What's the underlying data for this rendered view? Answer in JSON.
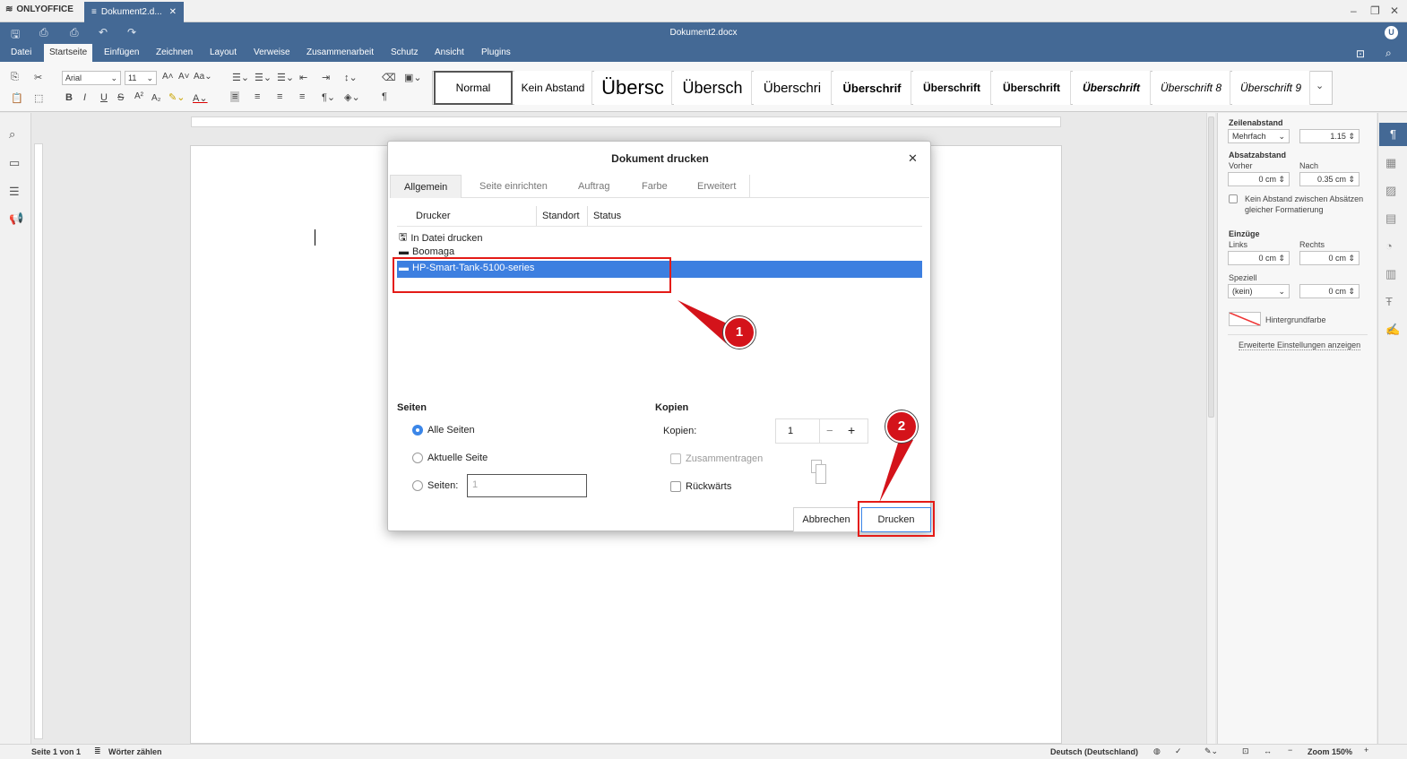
{
  "app": {
    "brand": "ONLYOFFICE",
    "tab": "Dokument2.d...",
    "title": "Dokument2.docx",
    "avatar": "U"
  },
  "menu": [
    "Datei",
    "Startseite",
    "Einfügen",
    "Zeichnen",
    "Layout",
    "Verweise",
    "Zusammenarbeit",
    "Schutz",
    "Ansicht",
    "Plugins"
  ],
  "toolbar": {
    "font": "Arial",
    "size": "11"
  },
  "styles": [
    "Normal",
    "Kein Abstand",
    "Übersc",
    "Übersch",
    "Überschri",
    "Überschrif",
    "Überschrift",
    "Überschrift",
    "Überschrift",
    "Überschrift 8",
    "Überschrift 9"
  ],
  "rpanel": {
    "line_spacing": "Zeilenabstand",
    "line_mode": "Mehrfach",
    "line_value": "1.15",
    "para_spacing": "Absatzabstand",
    "before": "Vorher",
    "after": "Nach",
    "before_val": "0 cm",
    "after_val": "0.35 cm",
    "no_space": "Kein Abstand zwischen Absätzen",
    "no_space2": "gleicher Formatierung",
    "indents": "Einzüge",
    "left": "Links",
    "right": "Rechts",
    "left_val": "0 cm",
    "right_val": "0 cm",
    "special": "Speziell",
    "special_val": "(kein)",
    "special_num": "0 cm",
    "bg": "Hintergrundfarbe",
    "advanced": "Erweiterte Einstellungen anzeigen"
  },
  "status": {
    "page": "Seite 1 von 1",
    "words": "Wörter zählen",
    "lang": "Deutsch (Deutschland)",
    "zoom": "Zoom 150%"
  },
  "dialog": {
    "title": "Dokument drucken",
    "tabs": [
      "Allgemein",
      "Seite einrichten",
      "Auftrag",
      "Farbe",
      "Erweitert"
    ],
    "cols": [
      "Drucker",
      "Standort",
      "Status"
    ],
    "printers": [
      "In Datei drucken",
      "Boomaga",
      "HP-Smart-Tank-5100-series"
    ],
    "pages": "Seiten",
    "all": "Alle Seiten",
    "current": "Aktuelle Seite",
    "range": "Seiten:",
    "range_ph": "1",
    "copies_grp": "Kopien",
    "copies_lbl": "Kopien:",
    "copies_val": "1",
    "collate": "Zusammentragen",
    "reverse": "Rückwärts",
    "minus": "−",
    "plus": "+",
    "cancel": "Abbrechen",
    "print": "Drucken"
  },
  "annotations": {
    "m1": "1",
    "m2": "2"
  }
}
